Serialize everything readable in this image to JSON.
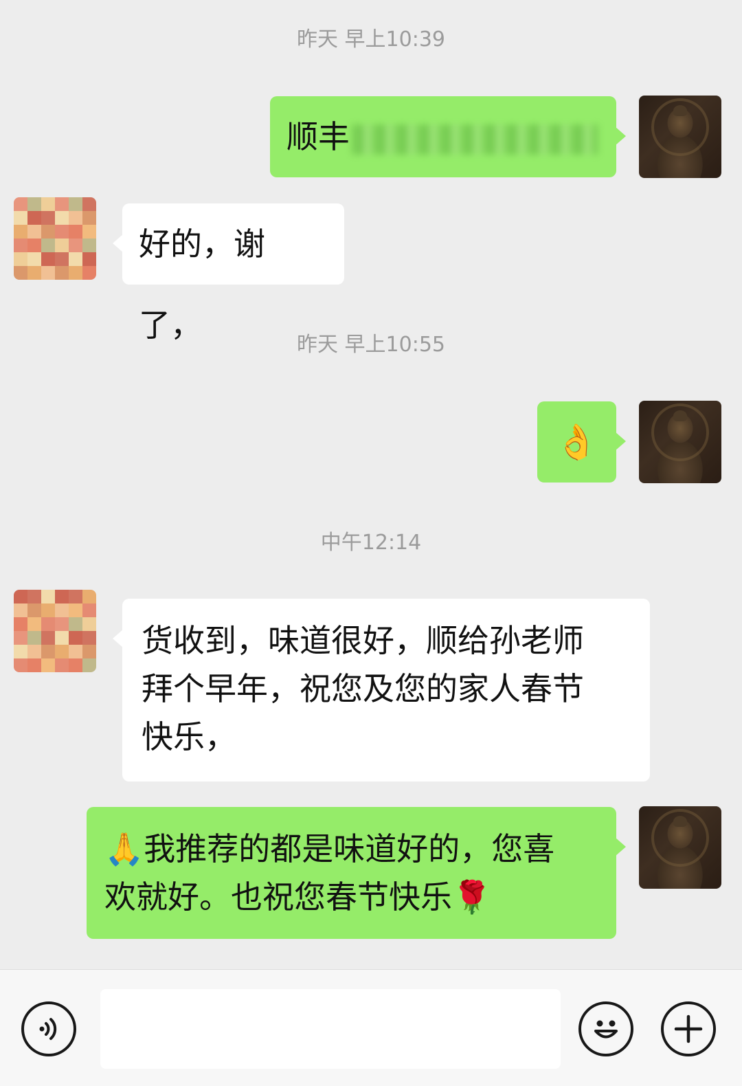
{
  "conversation": {
    "timestamps": [
      "昨天 早上10:39",
      "昨天 早上10:55",
      "中午12:14"
    ],
    "messages": [
      {
        "sender": "self",
        "text": "顺丰",
        "redacted": true
      },
      {
        "sender": "other",
        "text": "好的，谢了，"
      },
      {
        "sender": "self",
        "text": "👌"
      },
      {
        "sender": "other",
        "lines": [
          "货收到，味道很好，顺给孙老师",
          "拜个早年，祝您及您的家人春节",
          "快乐，"
        ]
      },
      {
        "sender": "self",
        "lines": [
          "🙏我推荐的都是味道好的，您喜",
          "欢就好。也祝您春节快乐🌹"
        ]
      }
    ]
  },
  "avatars": {
    "self": {
      "icon": "buddha-statue-avatar"
    },
    "other": {
      "icon": "pixelated-avatar"
    }
  },
  "input_bar": {
    "voice_icon": "voice-icon",
    "emoji_icon": "smiley-icon",
    "plus_icon": "plus-icon",
    "input_value": "",
    "input_placeholder": ""
  },
  "colors": {
    "background": "#ededed",
    "self_bubble": "#95ec69",
    "other_bubble": "#ffffff",
    "timestamp_text": "#9b9b9b"
  }
}
